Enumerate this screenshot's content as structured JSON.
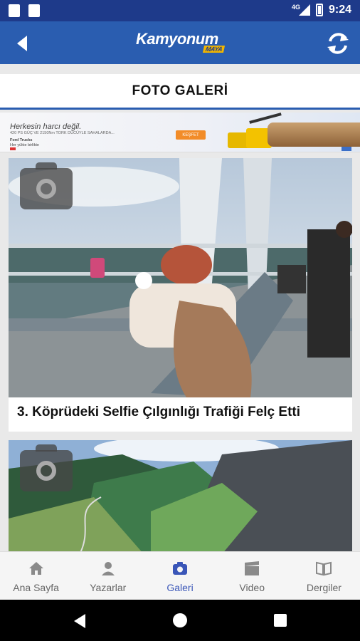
{
  "status_bar": {
    "time": "9:24",
    "network": "4G"
  },
  "app_bar": {
    "logo_text": "Kamyonum",
    "logo_sub": "MAYA"
  },
  "page_title": "FOTO GALERİ",
  "ad": {
    "headline": "Herkesin harcı değil.",
    "line1": "420 PS GÜÇ VE 2150Nm TORK DÜCÜYLE SAHALARDA...",
    "line2": "Ford Trucks",
    "line3": "Her yükte birlikte",
    "button": "KEŞFET"
  },
  "gallery": [
    {
      "title": "3. Köprüdeki Selfie Çılgınlığı Trafiği Felç Etti"
    },
    {
      "title": ""
    }
  ],
  "bottom_nav": {
    "items": [
      {
        "label": "Ana Sayfa",
        "icon": "home-icon"
      },
      {
        "label": "Yazarlar",
        "icon": "person-icon"
      },
      {
        "label": "Galeri",
        "icon": "camera-icon"
      },
      {
        "label": "Video",
        "icon": "clapperboard-icon"
      },
      {
        "label": "Dergiler",
        "icon": "book-icon"
      }
    ],
    "active_index": 2,
    "active_color": "#3a56b8"
  },
  "colors": {
    "status_bar": "#1e3a8a",
    "app_bar": "#2a5db0",
    "accent": "#2a5db0"
  }
}
